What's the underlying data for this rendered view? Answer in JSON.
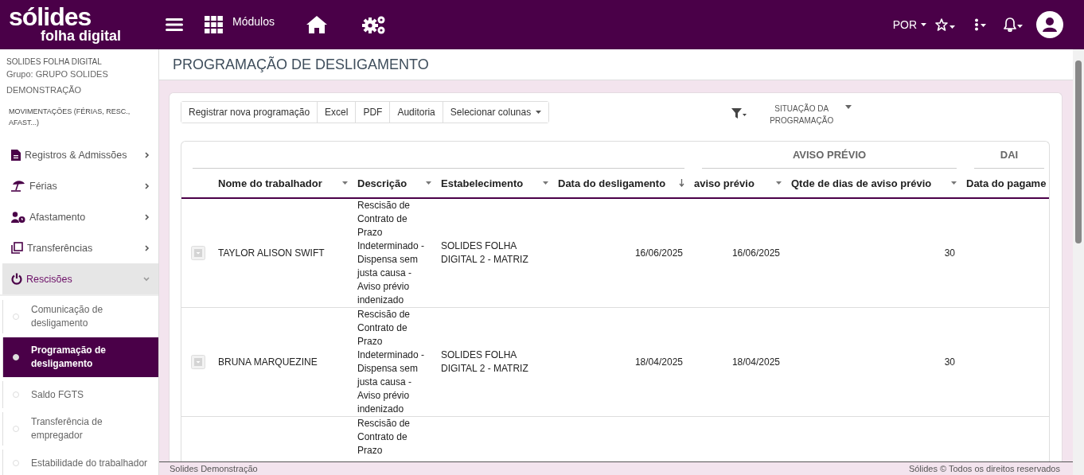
{
  "topbar": {
    "logo": {
      "name": "sólides",
      "product": "folha digital"
    },
    "modules_label": "Módulos",
    "language": "POR"
  },
  "sidebar": {
    "company": "SOLIDES FOLHA DIGITAL",
    "group": "Grupo: GRUPO SOLIDES DEMONSTRAÇÃO",
    "section": "MOVIMENTAÇÕES (FÉRIAS, RESC., AFAST...)",
    "items": [
      {
        "label": "Registros & Admissões",
        "expanded": false
      },
      {
        "label": "Férias",
        "expanded": false
      },
      {
        "label": "Afastamento",
        "expanded": false
      },
      {
        "label": "Transferências",
        "expanded": false
      },
      {
        "label": "Rescisões",
        "expanded": true,
        "children": [
          {
            "label": "Comunicação de desligamento",
            "selected": false
          },
          {
            "label": "Programação de desligamento",
            "selected": true
          },
          {
            "label": "Saldo FGTS",
            "selected": false
          },
          {
            "label": "Transferência de empregador",
            "selected": false
          },
          {
            "label": "Estabilidade do trabalhador",
            "selected": false
          }
        ]
      }
    ]
  },
  "page": {
    "title": "PROGRAMAÇÃO DE DESLIGAMENTO"
  },
  "toolbar": {
    "buttons": [
      {
        "label": "Registrar nova programação",
        "kind": "plain"
      },
      {
        "label": "Excel",
        "kind": "plain"
      },
      {
        "label": "PDF",
        "kind": "plain"
      },
      {
        "label": "Auditoria",
        "kind": "plain"
      },
      {
        "label": "Selecionar colunas",
        "kind": "dropdown"
      }
    ],
    "status_filter": "SITUAÇÃO DA PROGRAMAÇÃO"
  },
  "table": {
    "column_groups": [
      "AVISO PRÉVIO",
      "DAI"
    ],
    "columns": [
      {
        "label": "Nome do trabalhador",
        "sorted": false
      },
      {
        "label": "Descrição",
        "sorted": false
      },
      {
        "label": "Estabelecimento",
        "sorted": false
      },
      {
        "label": "Data do desligamento",
        "sorted": true
      },
      {
        "label": "aviso prévio",
        "sorted": false
      },
      {
        "label": "Qtde de dias de aviso prévio",
        "sorted": false
      },
      {
        "label": "Data do pagame"
      }
    ],
    "rows": [
      {
        "expandable": true,
        "cells": [
          "TAYLOR ALISON SWIFT",
          "Rescisão de Contrato de Prazo Indeterminado - Dispensa sem justa causa - Aviso prévio indenizado",
          "SOLIDES FOLHA DIGITAL 2 - MATRIZ",
          "16/06/2025",
          "16/06/2025",
          "30"
        ]
      },
      {
        "expandable": true,
        "cells": [
          "BRUNA MARQUEZINE",
          "Rescisão de Contrato de Prazo Indeterminado - Dispensa sem justa causa - Aviso prévio indenizado",
          "SOLIDES FOLHA DIGITAL 2 - MATRIZ",
          "18/04/2025",
          "18/04/2025",
          "30"
        ]
      },
      {
        "expandable": false,
        "cells": [
          "",
          "Rescisão de Contrato de Prazo"
        ]
      }
    ]
  },
  "footer": {
    "left": "Solides Demonstração",
    "right": "Sólides © Todos os direitos reservados"
  }
}
